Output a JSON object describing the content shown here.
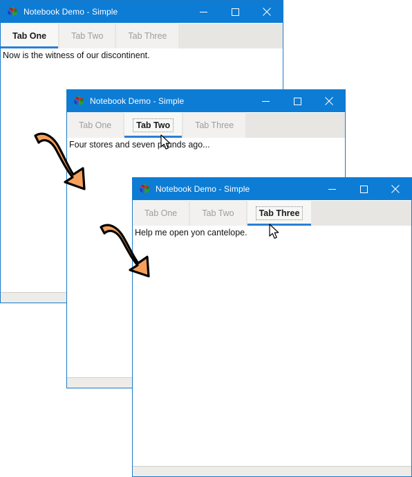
{
  "app": {
    "title": "Notebook Demo - Simple",
    "icon": "cube-icon",
    "accent_color": "#0d7cd5",
    "tab_underline_color": "#2a7fd4",
    "border_color": "#1879c9",
    "tabstrip_color": "#e8e6e3",
    "arrow_fill": "#f6a05a",
    "arrow_stroke": "#000000"
  },
  "window_controls": {
    "minimize_label": "—",
    "minimize_name": "minimize-button",
    "maximize_label": "□",
    "maximize_name": "maximize-button",
    "close_label": "✕",
    "close_name": "close-button"
  },
  "windows": [
    {
      "id": "win1",
      "title": "Notebook Demo - Simple",
      "active_tab_index": 0,
      "focus_ring": false,
      "tabs": [
        {
          "label": "Tab One"
        },
        {
          "label": "Tab Two"
        },
        {
          "label": "Tab Three"
        }
      ],
      "page_text": "Now is the witness of our discontinent."
    },
    {
      "id": "win2",
      "title": "Notebook Demo - Simple",
      "active_tab_index": 1,
      "focus_ring": true,
      "tabs": [
        {
          "label": "Tab One"
        },
        {
          "label": "Tab Two"
        },
        {
          "label": "Tab Three"
        }
      ],
      "page_text": "Four stores and seven pounds ago..."
    },
    {
      "id": "win3",
      "title": "Notebook Demo - Simple",
      "active_tab_index": 2,
      "focus_ring": true,
      "tabs": [
        {
          "label": "Tab One"
        },
        {
          "label": "Tab Two"
        },
        {
          "label": "Tab Three"
        }
      ],
      "page_text": "Help me open yon cantelope."
    }
  ],
  "annotations": {
    "arrows": [
      {
        "name": "arrow-window1-to-window2"
      },
      {
        "name": "arrow-window2-to-window3"
      }
    ],
    "cursors": [
      {
        "name": "mouse-cursor-on-tab-two"
      },
      {
        "name": "mouse-cursor-on-tab-three"
      }
    ]
  }
}
